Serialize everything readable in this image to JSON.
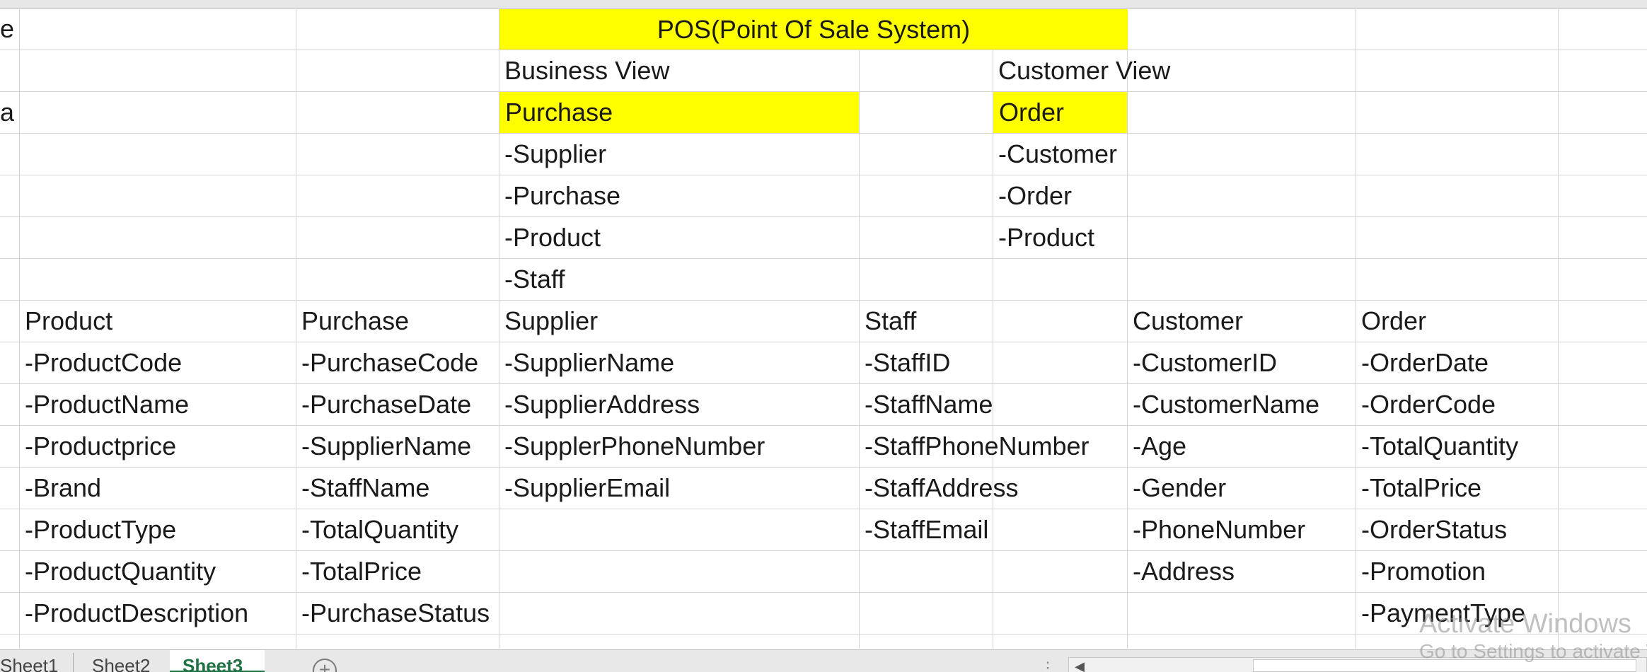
{
  "banner": {
    "title": "POS(Point Of Sale System)"
  },
  "left_clipped": {
    "row1": "e",
    "row3": "a"
  },
  "views": {
    "business": {
      "heading": "Business View",
      "highlight": "Purchase",
      "items": [
        "-Supplier",
        "-Purchase",
        "-Product",
        "-Staff"
      ]
    },
    "customer": {
      "heading": "Customer View",
      "highlight": "Order",
      "items": [
        "-Customer",
        "-Order",
        "-Product"
      ]
    }
  },
  "entities": [
    {
      "name": "Product",
      "fields": [
        "-ProductCode",
        "-ProductName",
        "-Productprice",
        "-Brand",
        "-ProductType",
        "-ProductQuantity",
        "-ProductDescription"
      ]
    },
    {
      "name": "Purchase",
      "fields": [
        "-PurchaseCode",
        "-PurchaseDate",
        "-SupplierName",
        "-StaffName",
        "-TotalQuantity",
        "-TotalPrice",
        "-PurchaseStatus"
      ]
    },
    {
      "name": "Supplier",
      "fields": [
        "-SupplierName",
        "-SupplierAddress",
        "-SupplerPhoneNumber",
        "-SupplierEmail"
      ]
    },
    {
      "name": "Staff",
      "fields": [
        "-StaffID",
        "-StaffName",
        "-StaffPhoneNumber",
        "-StaffAddress",
        "-StaffEmail"
      ]
    },
    {
      "name": "Customer",
      "fields": [
        "-CustomerID",
        "-CustomerName",
        "-Age",
        "-Gender",
        "-PhoneNumber",
        "-Address"
      ]
    },
    {
      "name": "Order",
      "fields": [
        "-OrderDate",
        "-OrderCode",
        "-TotalQuantity",
        "-TotalPrice",
        "-OrderStatus",
        "-Promotion",
        "-PaymentType"
      ]
    }
  ],
  "sheet_tabs": {
    "tabs": [
      "Sheet1",
      "Sheet2",
      "Sheet3"
    ],
    "active": "Sheet3",
    "add_symbol": "+",
    "dots": "⋮"
  },
  "watermark": {
    "line1": "Activate Windows",
    "line2": "Go to Settings to activate Windows."
  },
  "colors": {
    "highlight": "#ffff00",
    "gridline": "#d4d4d4",
    "active_tab": "#217346"
  }
}
